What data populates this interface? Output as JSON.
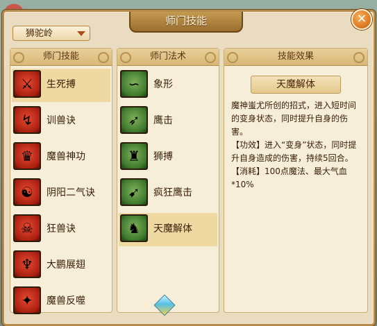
{
  "window": {
    "title": "师门技能",
    "close_symbol": "×"
  },
  "school_selector": {
    "selected": "狮驼岭"
  },
  "skills_panel": {
    "header": "师门技能",
    "items": [
      {
        "label": "生死搏",
        "icon": "sword-claw-icon",
        "selected": true
      },
      {
        "label": "训兽诀",
        "icon": "whip-icon",
        "selected": false
      },
      {
        "label": "魔兽神功",
        "icon": "beast-crown-icon",
        "selected": false
      },
      {
        "label": "阴阳二气诀",
        "icon": "yin-yang-mask-icon",
        "selected": false
      },
      {
        "label": "狂兽诀",
        "icon": "beast-skull-icon",
        "selected": false
      },
      {
        "label": "大鹏展翅",
        "icon": "roc-wings-icon",
        "selected": false
      },
      {
        "label": "魔兽反噬",
        "icon": "beast-bite-icon",
        "selected": false
      }
    ]
  },
  "spells_panel": {
    "header": "师门法术",
    "items": [
      {
        "label": "象形",
        "icon": "elephant-icon",
        "selected": false
      },
      {
        "label": "鹰击",
        "icon": "eagle-icon",
        "selected": false
      },
      {
        "label": "狮搏",
        "icon": "lion-icon",
        "selected": false
      },
      {
        "label": "疯狂鹰击",
        "icon": "frenzy-eagle-icon",
        "selected": false
      },
      {
        "label": "天魔解体",
        "icon": "demon-body-icon",
        "selected": true
      }
    ]
  },
  "effect_panel": {
    "header": "技能效果",
    "title": "天魔解体",
    "description": "魔神蚩尤所创的招式，进入短时间的变身状态，同时提升自身的伤害。\n【功效】进入“变身”状态，同时提升自身造成的伤害，持续5回合。\n【消耗】100点魔法、最大气血*10%"
  },
  "colors": {
    "frame": "#b58a4b",
    "panel_bg": "#f6eed9",
    "selected_row": "#efd9a2",
    "close_button": "#d9731e"
  }
}
